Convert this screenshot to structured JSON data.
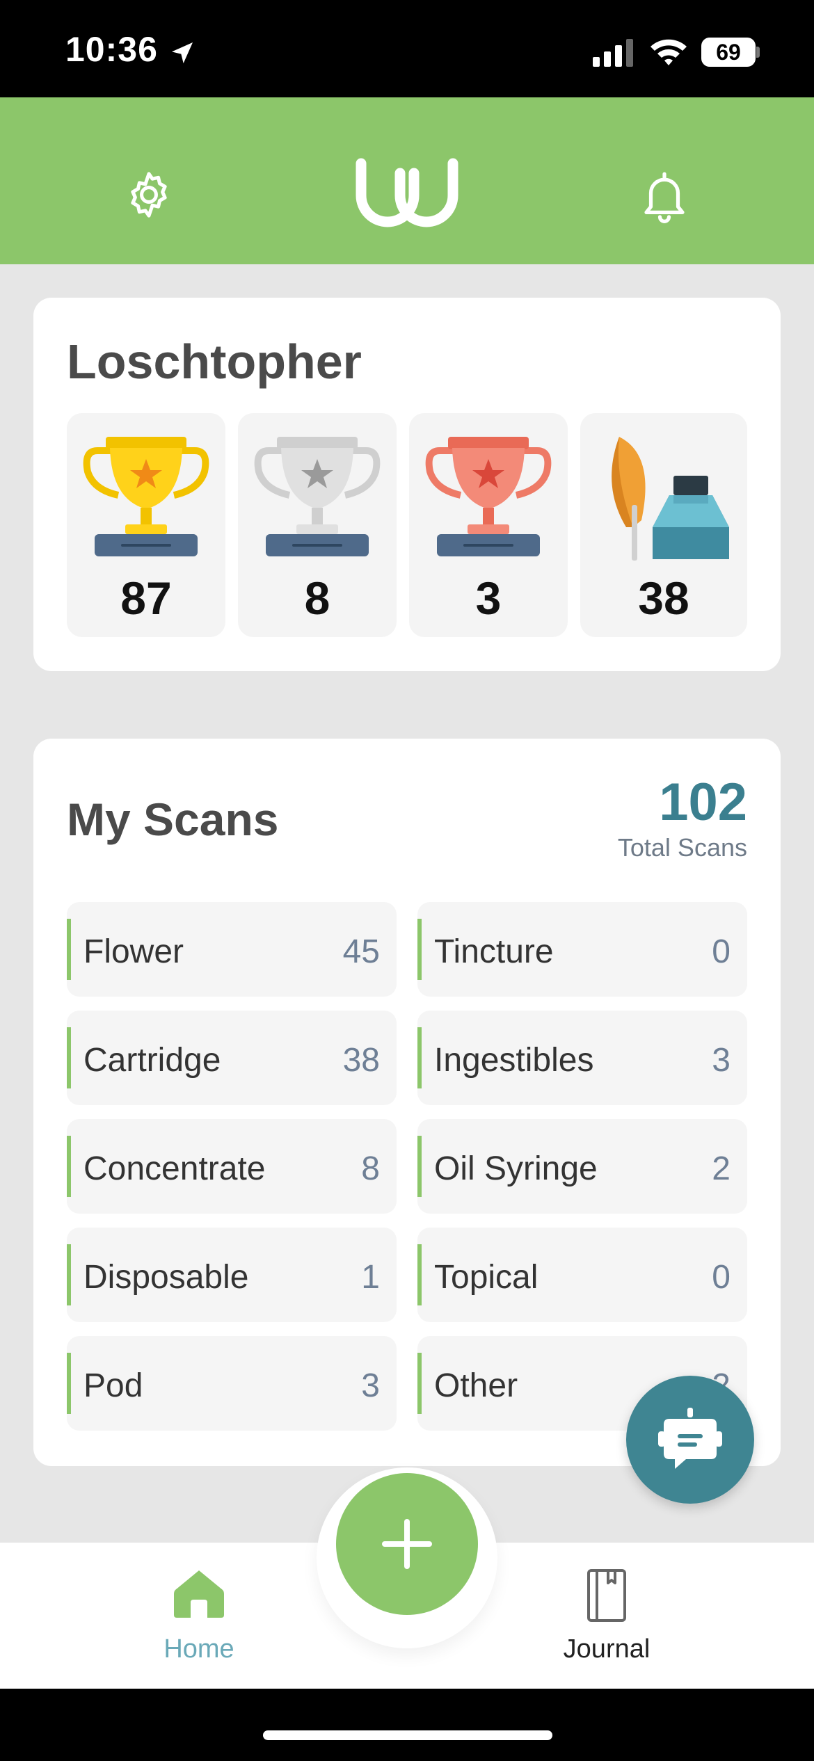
{
  "status_bar": {
    "time": "10:36",
    "battery": "69",
    "icons": [
      "location-arrow-icon",
      "cellular-signal-icon",
      "wifi-icon",
      "battery-icon"
    ]
  },
  "header": {
    "background_color": "#8cc66a",
    "icons": [
      "gear-icon",
      "app-logo",
      "bell-icon"
    ]
  },
  "profile": {
    "username": "Loschtopher",
    "stats": [
      {
        "icon": "gold-trophy-icon",
        "value": "87"
      },
      {
        "icon": "silver-trophy-icon",
        "value": "8"
      },
      {
        "icon": "bronze-trophy-icon",
        "value": "3"
      },
      {
        "icon": "quill-ink-icon",
        "value": "38"
      }
    ]
  },
  "scans": {
    "title": "My Scans",
    "total": "102",
    "total_label": "Total Scans",
    "accent_color": "#3b7f8f",
    "items": [
      {
        "label": "Flower",
        "count": "45"
      },
      {
        "label": "Tincture",
        "count": "0"
      },
      {
        "label": "Cartridge",
        "count": "38"
      },
      {
        "label": "Ingestibles",
        "count": "3"
      },
      {
        "label": "Concentrate",
        "count": "8"
      },
      {
        "label": "Oil Syringe",
        "count": "2"
      },
      {
        "label": "Disposable",
        "count": "1"
      },
      {
        "label": "Topical",
        "count": "0"
      },
      {
        "label": "Pod",
        "count": "3"
      },
      {
        "label": "Other",
        "count": "2"
      }
    ]
  },
  "chat_button": {
    "icon": "chat-bot-icon",
    "color": "#3f8592"
  },
  "add_button": {
    "icon": "plus-icon",
    "color": "#8cc66a"
  },
  "bottom_nav": {
    "home_label": "Home",
    "journal_label": "Journal",
    "active_color": "#6aa9b8"
  }
}
